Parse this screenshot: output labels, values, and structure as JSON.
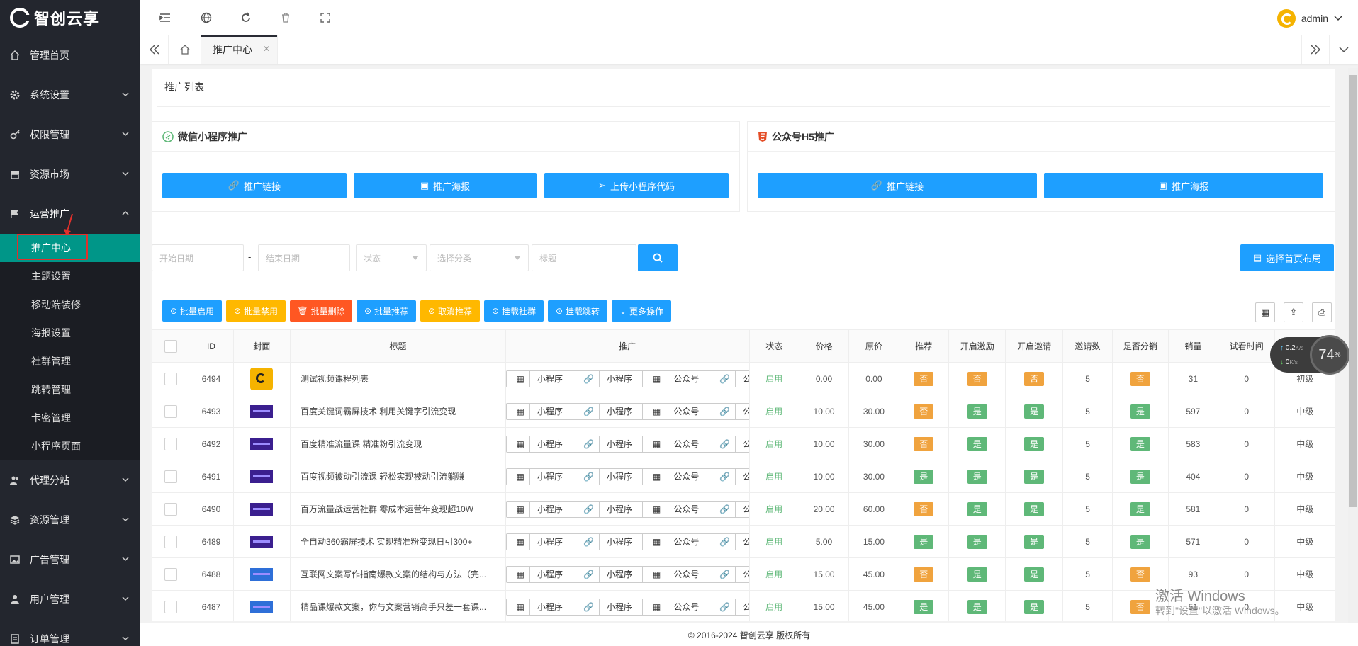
{
  "brand": {
    "name": "智创云享"
  },
  "sidebar": {
    "items": [
      {
        "label": "管理首页",
        "icon": "home-icon"
      },
      {
        "label": "系统设置",
        "icon": "gear-icon"
      },
      {
        "label": "权限管理",
        "icon": "key-icon"
      },
      {
        "label": "资源市场",
        "icon": "store-icon"
      },
      {
        "label": "运营推广",
        "icon": "flag-icon",
        "open": true
      }
    ],
    "sub": [
      "推广中心",
      "主题设置",
      "移动端装修",
      "海报设置",
      "社群管理",
      "跳转管理",
      "卡密管理",
      "小程序页面"
    ],
    "items2": [
      {
        "label": "代理分站",
        "icon": "users-icon"
      },
      {
        "label": "资源管理",
        "icon": "layers-icon"
      },
      {
        "label": "广告管理",
        "icon": "image-icon"
      },
      {
        "label": "用户管理",
        "icon": "user-icon"
      },
      {
        "label": "订单管理",
        "icon": "order-icon"
      }
    ]
  },
  "topbar": {
    "user": "admin"
  },
  "tabs": {
    "active": "推广中心"
  },
  "page": {
    "tab": "推广列表",
    "cards": {
      "miniprogram": {
        "title": "微信小程序推广",
        "buttons": [
          "推广链接",
          "推广海报",
          "上传小程序代码"
        ]
      },
      "h5": {
        "title": "公众号H5推广",
        "buttons": [
          "推广链接",
          "推广海报"
        ]
      }
    },
    "filters": {
      "start": "开始日期",
      "end": "结束日期",
      "status": "状态",
      "category": "选择分类",
      "title": "标题",
      "dash": "-"
    },
    "layout_btn": "选择首页布局",
    "actions": [
      {
        "label": "批量启用",
        "color": "#1e9fff"
      },
      {
        "label": "批量禁用",
        "color": "#ffb800"
      },
      {
        "label": "批量删除",
        "color": "#ff5722"
      },
      {
        "label": "批量推荐",
        "color": "#1e9fff"
      },
      {
        "label": "取消推荐",
        "color": "#ffb800"
      },
      {
        "label": "挂载社群",
        "color": "#1e9fff"
      },
      {
        "label": "挂载跳转",
        "color": "#1e9fff"
      },
      {
        "label": "更多操作",
        "color": "#1e9fff"
      }
    ]
  },
  "table": {
    "headers": [
      "",
      "ID",
      "封面",
      "标题",
      "推广",
      "状态",
      "价格",
      "原价",
      "推荐",
      "开启激励",
      "开启邀请",
      "邀请数",
      "是否分销",
      "销量",
      "试看时间",
      ""
    ],
    "promo_labels": [
      "小程序",
      "小程序",
      "公众号",
      "公众号"
    ],
    "rows": [
      {
        "id": "6494",
        "title": "测试视频课程列表",
        "status": "启用",
        "price": "0.00",
        "orig": "0.00",
        "rec": "否",
        "inc": "否",
        "inv": "否",
        "invites": "5",
        "dist": "否",
        "sales": "31",
        "trial": "0",
        "level": "初级",
        "cover": "logo"
      },
      {
        "id": "6493",
        "title": "百度关键词霸屏技术 利用关键字引流变现",
        "status": "启用",
        "price": "10.00",
        "orig": "30.00",
        "rec": "否",
        "inc": "是",
        "inv": "是",
        "invites": "5",
        "dist": "是",
        "sales": "597",
        "trial": "0",
        "level": "中级",
        "cover": "purple"
      },
      {
        "id": "6492",
        "title": "百度精准流量课 精准粉引流变现",
        "status": "启用",
        "price": "10.00",
        "orig": "30.00",
        "rec": "否",
        "inc": "是",
        "inv": "是",
        "invites": "5",
        "dist": "是",
        "sales": "583",
        "trial": "0",
        "level": "中级",
        "cover": "purple"
      },
      {
        "id": "6491",
        "title": "百度视频被动引流课 轻松实现被动引流躺赚",
        "status": "启用",
        "price": "10.00",
        "orig": "30.00",
        "rec": "是",
        "inc": "是",
        "inv": "是",
        "invites": "5",
        "dist": "是",
        "sales": "404",
        "trial": "0",
        "level": "中级",
        "cover": "purple"
      },
      {
        "id": "6490",
        "title": "百万流量战运营社群 零成本运营年变现超10W",
        "status": "启用",
        "price": "20.00",
        "orig": "60.00",
        "rec": "否",
        "inc": "是",
        "inv": "是",
        "invites": "5",
        "dist": "是",
        "sales": "581",
        "trial": "0",
        "level": "中级",
        "cover": "purple"
      },
      {
        "id": "6489",
        "title": "全自动360霸屏技术 实现精准粉变现日引300+",
        "status": "启用",
        "price": "5.00",
        "orig": "15.00",
        "rec": "是",
        "inc": "是",
        "inv": "是",
        "invites": "5",
        "dist": "是",
        "sales": "571",
        "trial": "0",
        "level": "中级",
        "cover": "purple"
      },
      {
        "id": "6488",
        "title": "互联网文案写作指南爆款文案的结构与方法（完...",
        "status": "启用",
        "price": "15.00",
        "orig": "45.00",
        "rec": "否",
        "inc": "是",
        "inv": "是",
        "invites": "5",
        "dist": "否",
        "sales": "93",
        "trial": "0",
        "level": "中级",
        "cover": "blue"
      },
      {
        "id": "6487",
        "title": "精品课爆款文案，你与文案营销高手只差一套课...",
        "status": "启用",
        "price": "15.00",
        "orig": "45.00",
        "rec": "是",
        "inc": "是",
        "inv": "是",
        "invites": "5",
        "dist": "否",
        "sales": "51",
        "trial": "0",
        "level": "中级",
        "cover": "blue"
      }
    ]
  },
  "footer": "© 2016-2024 智创云享 版权所有",
  "speed": {
    "up": "0.2",
    "down": "0",
    "unit": "K/s",
    "percent": "74"
  },
  "watermark": {
    "line1": "激活 Windows",
    "line2": "转到\"设置\"以激活 Windows。"
  }
}
